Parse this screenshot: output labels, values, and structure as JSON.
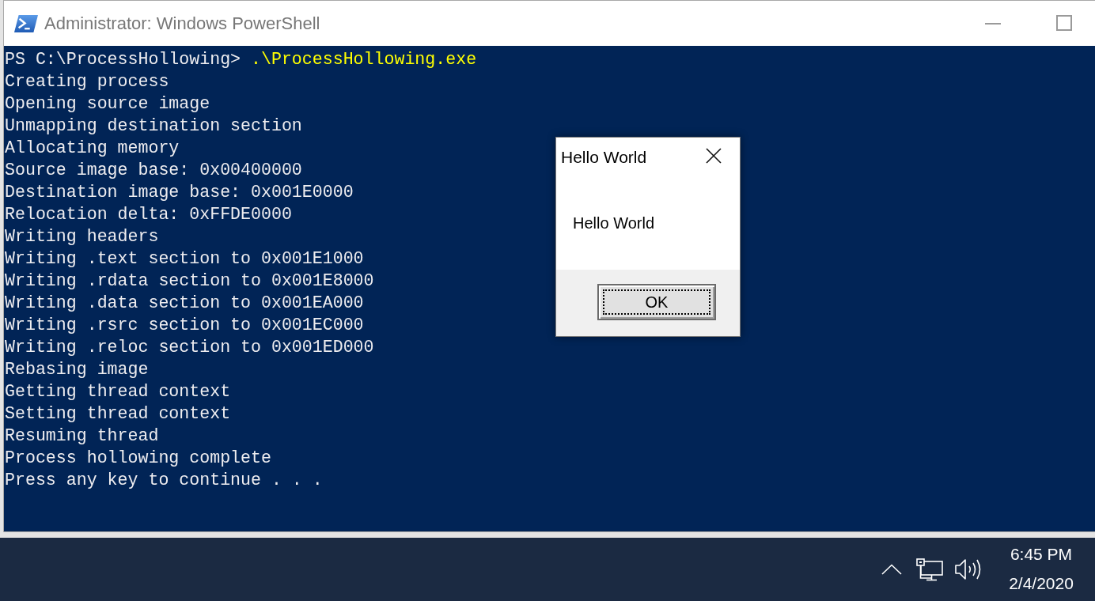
{
  "window": {
    "title": "Administrator: Windows PowerShell",
    "active": false
  },
  "console": {
    "lines": [
      {
        "kind": "command",
        "prompt": "PS C:\\ProcessHollowing>",
        "command": ".\\ProcessHollowing.exe"
      },
      {
        "kind": "output",
        "text": "Creating process"
      },
      {
        "kind": "output",
        "text": "Opening source image"
      },
      {
        "kind": "output",
        "text": "Unmapping destination section"
      },
      {
        "kind": "output",
        "text": "Allocating memory"
      },
      {
        "kind": "output",
        "text": "Source image base: 0x00400000"
      },
      {
        "kind": "output",
        "text": "Destination image base: 0x001E0000"
      },
      {
        "kind": "output",
        "text": "Relocation delta: 0xFFDE0000"
      },
      {
        "kind": "output",
        "text": "Writing headers"
      },
      {
        "kind": "output",
        "text": "Writing .text section to 0x001E1000"
      },
      {
        "kind": "output",
        "text": "Writing .rdata section to 0x001E8000"
      },
      {
        "kind": "output",
        "text": "Writing .data section to 0x001EA000"
      },
      {
        "kind": "output",
        "text": "Writing .rsrc section to 0x001EC000"
      },
      {
        "kind": "output",
        "text": "Writing .reloc section to 0x001ED000"
      },
      {
        "kind": "output",
        "text": "Rebasing image"
      },
      {
        "kind": "output",
        "text": "Getting thread context"
      },
      {
        "kind": "output",
        "text": "Setting thread context"
      },
      {
        "kind": "output",
        "text": "Resuming thread"
      },
      {
        "kind": "output",
        "text": "Process hollowing complete"
      },
      {
        "kind": "output",
        "text": "Press any key to continue . . ."
      }
    ]
  },
  "dialog": {
    "title": "Hello World",
    "message": "Hello World",
    "button": {
      "label": "OK",
      "focused": true
    }
  },
  "taskbar": {
    "time": "6:45 PM",
    "date": "2/4/2020"
  }
}
